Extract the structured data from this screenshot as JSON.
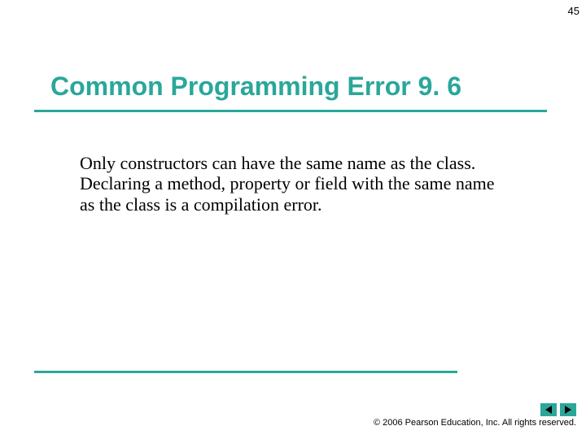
{
  "page_number": "45",
  "title": "Common Programming Error 9. 6",
  "body": "Only constructors can have the same name as the class. Declaring a method, property or field with the same name as the class is a compilation error.",
  "copyright": "© 2006 Pearson Education, Inc.  All rights reserved.",
  "colors": {
    "accent": "#2aa79a"
  }
}
